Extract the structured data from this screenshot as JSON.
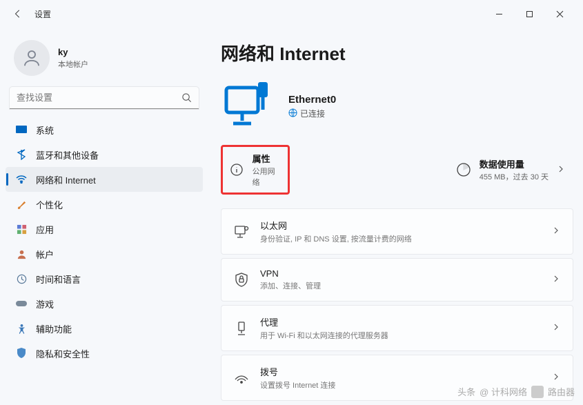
{
  "window": {
    "title": "设置"
  },
  "user": {
    "name": "ky",
    "account": "本地帐户"
  },
  "search": {
    "placeholder": "查找设置"
  },
  "sidebar": {
    "items": [
      {
        "label": "系统"
      },
      {
        "label": "蓝牙和其他设备"
      },
      {
        "label": "网络和 Internet"
      },
      {
        "label": "个性化"
      },
      {
        "label": "应用"
      },
      {
        "label": "帐户"
      },
      {
        "label": "时间和语言"
      },
      {
        "label": "游戏"
      },
      {
        "label": "辅助功能"
      },
      {
        "label": "隐私和安全性"
      }
    ]
  },
  "page": {
    "title": "网络和 Internet"
  },
  "network": {
    "name": "Ethernet0",
    "status": "已连接"
  },
  "top": {
    "properties": {
      "label": "属性",
      "sub": "公用网络"
    },
    "data": {
      "label": "数据使用量",
      "sub": "455 MB，过去 30 天"
    }
  },
  "cards": [
    {
      "label": "以太网",
      "sub": "身份验证, IP 和 DNS 设置, 按流量计费的网络"
    },
    {
      "label": "VPN",
      "sub": "添加、连接、管理"
    },
    {
      "label": "代理",
      "sub": "用于 Wi-Fi 和以太网连接的代理服务器"
    },
    {
      "label": "拨号",
      "sub": "设置拨号 Internet 连接"
    }
  ],
  "watermark": {
    "prefix": "头条",
    "handle": "@ 计科网络",
    "badge": "路由器"
  }
}
